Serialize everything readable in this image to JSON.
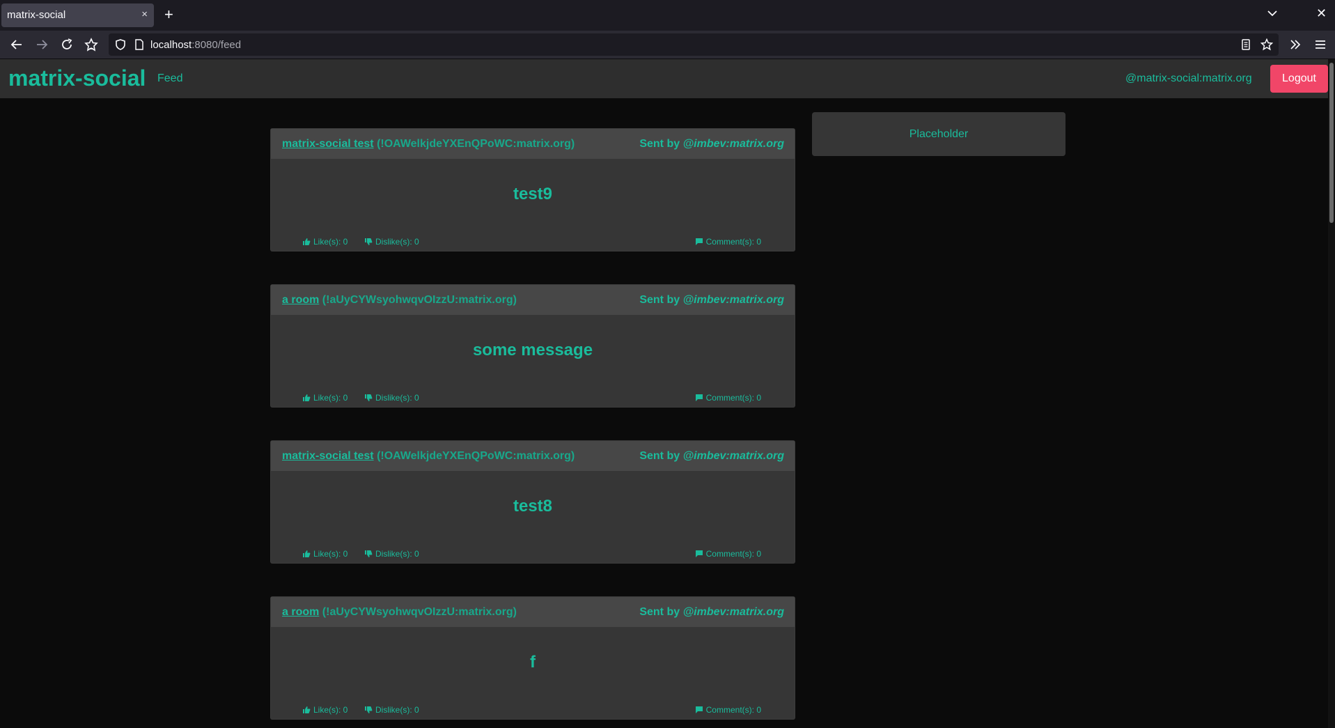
{
  "browser": {
    "tab_title": "matrix-social",
    "tab_close": "×",
    "new_tab": "+",
    "window_close": "✕",
    "url_host": "localhost",
    "url_rest": ":8080/feed"
  },
  "header": {
    "brand": "matrix-social",
    "nav_feed": "Feed",
    "user_id": "@matrix-social:matrix.org",
    "logout": "Logout"
  },
  "sidebar": {
    "placeholder": "Placeholder"
  },
  "posts": [
    {
      "room_name": "matrix-social test",
      "room_id": "(!OAWelkjdeYXEnQPoWC:matrix.org)",
      "sent_by_label": "Sent by",
      "sender": "@imbev:matrix.org",
      "body": "test9",
      "likes": "Like(s): 0",
      "dislikes": "Dislike(s): 0",
      "comments": "Comment(s): 0"
    },
    {
      "room_name": "a room",
      "room_id": "(!aUyCYWsyohwqvOIzzU:matrix.org)",
      "sent_by_label": "Sent by",
      "sender": "@imbev:matrix.org",
      "body": "some message",
      "likes": "Like(s): 0",
      "dislikes": "Dislike(s): 0",
      "comments": "Comment(s): 0"
    },
    {
      "room_name": "matrix-social test",
      "room_id": "(!OAWelkjdeYXEnQPoWC:matrix.org)",
      "sent_by_label": "Sent by",
      "sender": "@imbev:matrix.org",
      "body": "test8",
      "likes": "Like(s): 0",
      "dislikes": "Dislike(s): 0",
      "comments": "Comment(s): 0"
    },
    {
      "room_name": "a room",
      "room_id": "(!aUyCYWsyohwqvOIzzU:matrix.org)",
      "sent_by_label": "Sent by",
      "sender": "@imbev:matrix.org",
      "body": "f",
      "likes": "Like(s): 0",
      "dislikes": "Dislike(s): 0",
      "comments": "Comment(s): 0"
    }
  ],
  "colors": {
    "accent": "#1abc9c",
    "logout": "#f14668",
    "page_bg": "#0b0b0b",
    "card_bg": "#363636",
    "card_head_bg": "#474747"
  }
}
